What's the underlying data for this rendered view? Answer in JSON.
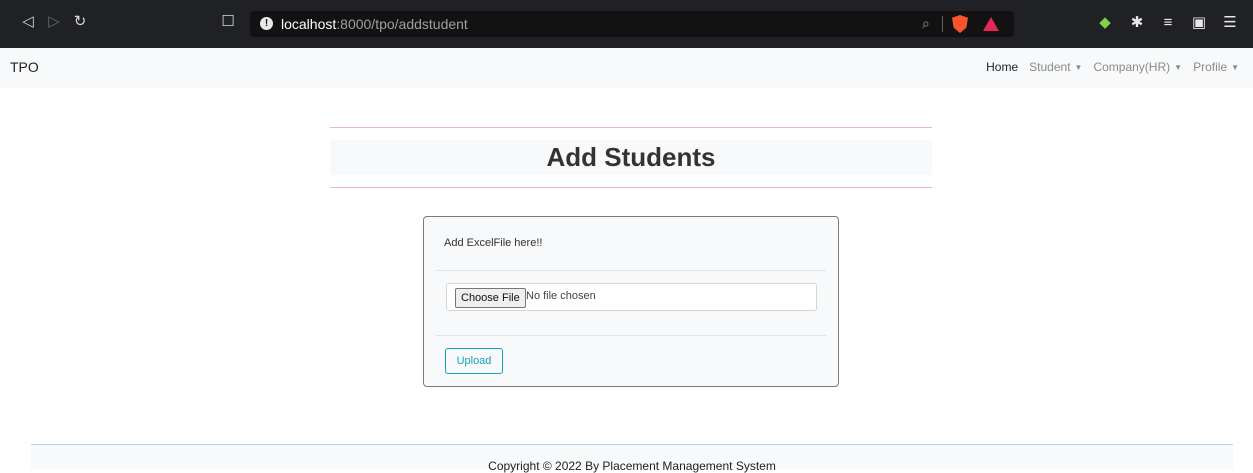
{
  "browser": {
    "url_host": "localhost",
    "url_path": ":8000/tpo/addstudent",
    "icons": [
      "back-icon",
      "forward-icon",
      "reload-icon",
      "bookmark-icon",
      "info-icon",
      "zoom-icon",
      "brave-shield-icon",
      "brave-rewards-icon",
      "extension-icon",
      "puzzle-icon",
      "playlist-icon",
      "wallet-icon",
      "menu-icon"
    ]
  },
  "navbar": {
    "brand": "TPO",
    "links": [
      {
        "label": "Home",
        "active": true
      },
      {
        "label": "Student",
        "dropdown": true
      },
      {
        "label": "Company(HR)",
        "dropdown": true
      },
      {
        "label": "Profile",
        "dropdown": true
      }
    ]
  },
  "main": {
    "title": "Add Students",
    "card": {
      "header": "Add ExcelFile here!!",
      "file_input": {
        "button_label": "Choose File",
        "status": "No file chosen"
      },
      "submit_label": "Upload"
    }
  },
  "footer": {
    "copyright": "Copyright © 2022 By Placement Management System"
  },
  "colors": {
    "browser_chrome": "#202124",
    "navbar_bg": "#f8f9fa",
    "accent_info": "#17a2b8",
    "title_border": "#f3b6b6"
  }
}
